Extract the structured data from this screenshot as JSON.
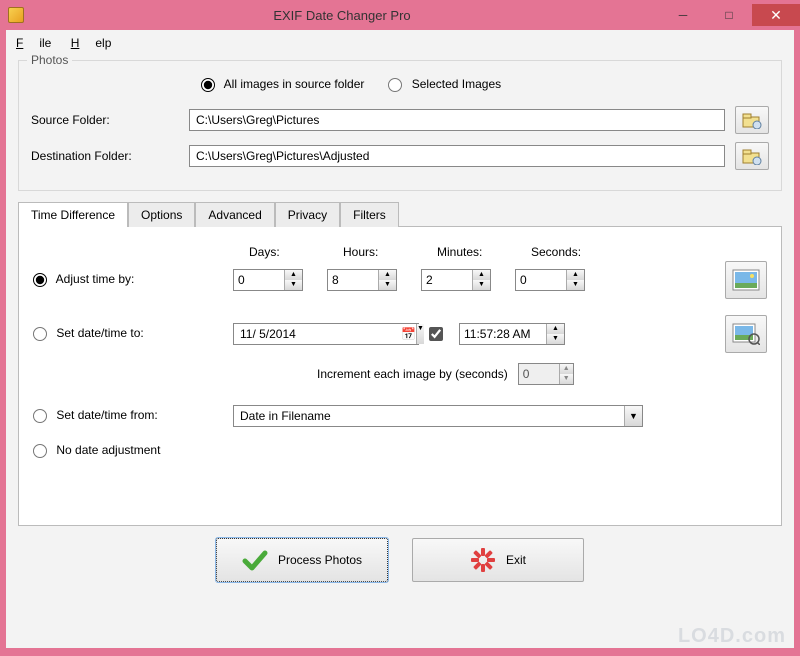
{
  "window": {
    "title": "EXIF Date Changer Pro"
  },
  "menu": {
    "file": "File",
    "help": "Help"
  },
  "photos": {
    "legend": "Photos",
    "all_images": "All images in source folder",
    "selected_images": "Selected Images",
    "source_label": "Source Folder:",
    "source_value": "C:\\Users\\Greg\\Pictures",
    "dest_label": "Destination Folder:",
    "dest_value": "C:\\Users\\Greg\\Pictures\\Adjusted"
  },
  "tabs": {
    "time_difference": "Time Difference",
    "options": "Options",
    "advanced": "Advanced",
    "privacy": "Privacy",
    "filters": "Filters"
  },
  "time": {
    "adjust_label": "Adjust time by:",
    "days_label": "Days:",
    "days_value": "0",
    "hours_label": "Hours:",
    "hours_value": "8",
    "minutes_label": "Minutes:",
    "minutes_value": "2",
    "seconds_label": "Seconds:",
    "seconds_value": "0",
    "set_to_label": "Set date/time to:",
    "date_value": "11/ 5/2014",
    "time_value": "11:57:28 AM",
    "increment_label": "Increment each image by (seconds)",
    "increment_value": "0",
    "set_from_label": "Set date/time from:",
    "set_from_value": "Date in Filename",
    "no_adjust_label": "No date adjustment"
  },
  "buttons": {
    "process": "Process Photos",
    "exit": "Exit"
  },
  "watermark": "LO4D.com"
}
